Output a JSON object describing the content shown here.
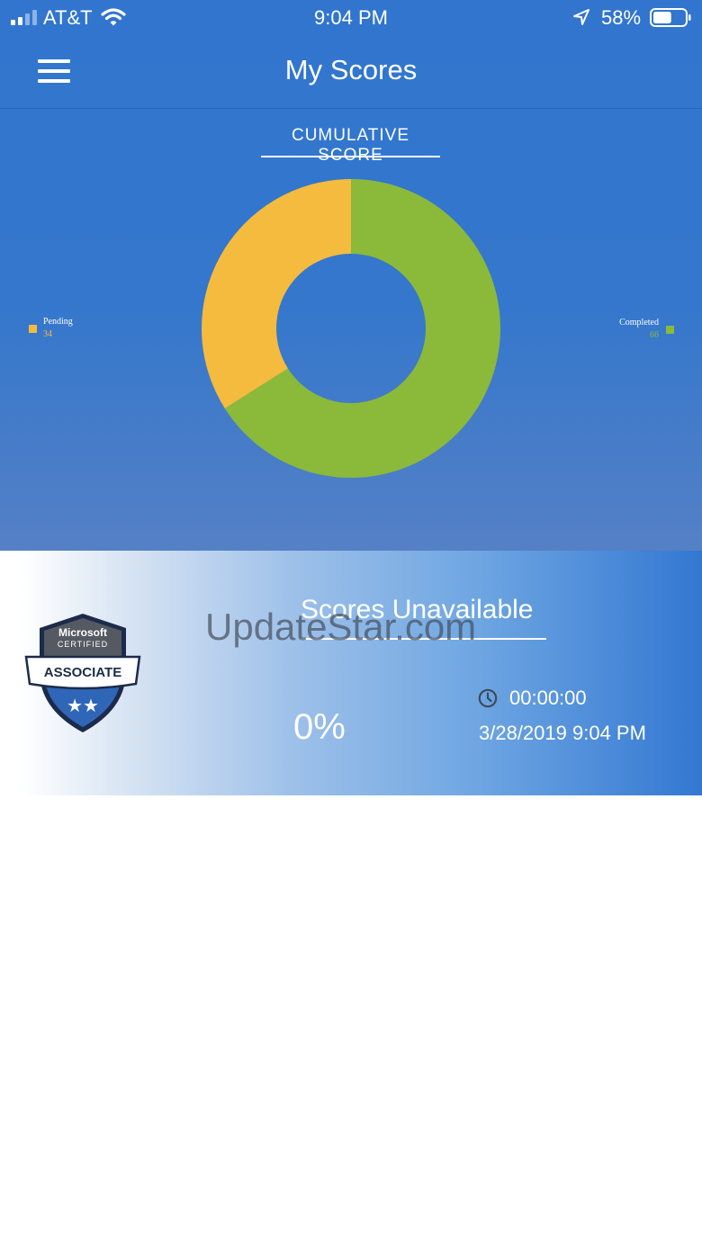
{
  "status_bar": {
    "carrier": "AT&T",
    "time": "9:04 PM",
    "battery_percent": "58%",
    "battery_level": 0.58,
    "icons": [
      "signal-icon",
      "wifi-icon",
      "location-arrow-icon",
      "battery-icon"
    ]
  },
  "header": {
    "title": "My Scores",
    "menu_icon": "hamburger-menu-icon"
  },
  "chart_section": {
    "title": "CUMULATIVE SCORE"
  },
  "chart_data": {
    "type": "pie",
    "variant": "donut",
    "categories": [
      "Pending",
      "Completed"
    ],
    "values": [
      34,
      66
    ],
    "colors": [
      "#f4bb3e",
      "#8bb93a"
    ],
    "legend": {
      "left": "Pending",
      "right": "Completed"
    }
  },
  "score_card": {
    "status": "Scores Unavailable",
    "watermark": "UpdateStar.com",
    "percent": "0%",
    "timer": "00:00:00",
    "datetime": "3/28/2019 9:04 PM",
    "clock_icon": "clock-icon",
    "badge": {
      "line1": "Microsoft",
      "line2": "CERTIFIED",
      "ribbon": "ASSOCIATE",
      "stars": "★★"
    }
  },
  "colors": {
    "header_blue": "#3175cf",
    "pending": "#f4bb3e",
    "completed": "#8bb93a",
    "badge_dark": "#1c2b4a",
    "badge_blue": "#2f66b8"
  }
}
